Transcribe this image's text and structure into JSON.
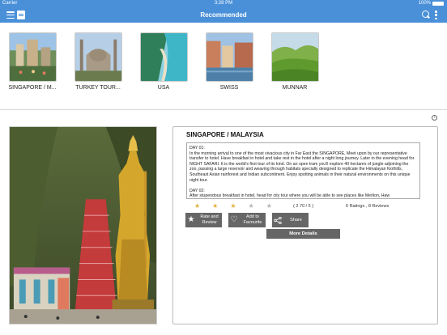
{
  "status_bar": {
    "carrier": "Carrier",
    "time": "3:28 PM",
    "battery": "100%"
  },
  "nav": {
    "title": "Recommended"
  },
  "destinations": [
    {
      "label": "SINGAPORE / M..."
    },
    {
      "label": "TURKEY TOUR..."
    },
    {
      "label": "USA"
    },
    {
      "label": "SWISS"
    },
    {
      "label": "MUNNAR"
    }
  ],
  "detail": {
    "title": "SINGAPORE / MALAYSIA",
    "description": [
      "DAY 01:",
      "In the morning arrival to one of the most vivacious city in Far East the SINGAPORE, Meet upon by our representative transfer to hotel. Have breakfast in hotel and take rest in the hotel after a night long journey. Later in the evening head for NIGHT SAFARI. It is the world's first tour of its kind. On an open tram you'll explore 40 hectares of jungle adjoining the zoo, passing a large reservoir and weaving through habitats specially designed to replicate the Himalayan foothills, Southeast Asian rainforest and Indian subcontinent. Enjoy spotting animals in their natural environments on this unique night tour.",
      "DAY 02:",
      "After stupendous breakfast in hotel, head for city tour where you will be able to see places like Merlion, Haw"
    ],
    "rating_value": 2.7,
    "rating_max": 5,
    "rating_text": "( 2.70 / 5 )",
    "rating_count": "6 Ratings , 8 Reviews",
    "buttons": {
      "rate": "Rate and Review",
      "favourite": "Add to Favourite",
      "share": "Share",
      "more": "More Details"
    }
  },
  "colors": {
    "nav_bar": "#4a90d9",
    "button": "#666666",
    "star_on": "#e0b23a",
    "star_off": "#b5b5b5"
  }
}
